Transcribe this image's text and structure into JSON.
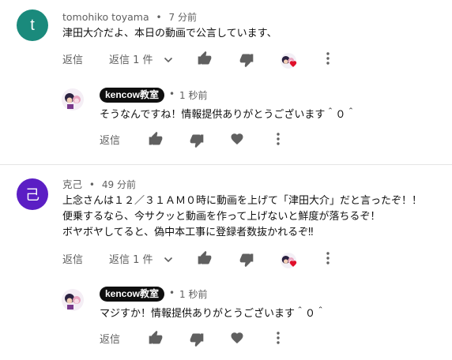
{
  "comment1": {
    "author": "tomohiko toyama",
    "time": "7 分前",
    "text": "津田大介だよ、本日の動画で公言しています、",
    "avatar_letter": "t",
    "avatar_color": "#1a8a7c",
    "reply_label": "返信",
    "replies_label": "返信 1 件",
    "reply": {
      "author": "kencow教室",
      "time": "1 秒前",
      "text": "そうなんですね！情報提供ありがとうございます＾０＾",
      "reply_label": "返信"
    }
  },
  "comment2": {
    "author": "克己",
    "time": "49 分前",
    "avatar_letter": "己",
    "avatar_color": "#5b1ec4",
    "text_lines": [
      "上念さんは１２／３１ＡＭ０時に動画を上げて「津田大介」だと言ったぞ！！",
      "便乗するなら、今サクッと動画を作って上げないと鮮度が落ちるぞ！",
      "ボヤボヤしてると、偽中本工事に登録者数抜かれるぞ‼"
    ],
    "reply_label": "返信",
    "replies_label": "返信 1 件",
    "reply": {
      "author": "kencow教室",
      "time": "1 秒前",
      "text": "マジすか！情報提供ありがとうございます＾０＾",
      "reply_label": "返信"
    }
  },
  "colors": {
    "divider": "#e5e5e5",
    "secondary_text": "#606060",
    "heart": "#e0102a"
  }
}
